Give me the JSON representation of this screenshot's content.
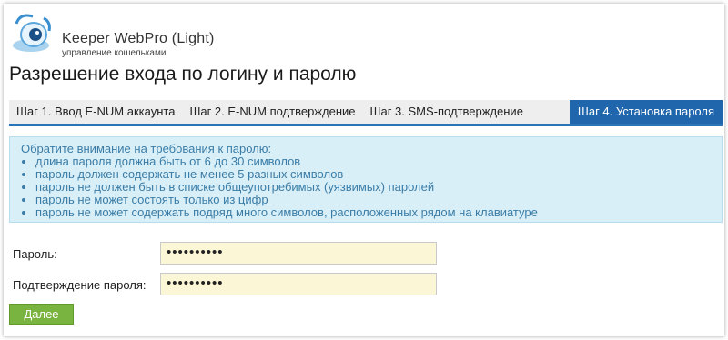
{
  "header": {
    "title": "Keeper WebPro (Light)",
    "subtitle": "управление кошельками"
  },
  "page_title": "Разрешение входа по логину и паролю",
  "steps": [
    {
      "label": "Шаг 1. Ввод E-NUM аккаунта",
      "active": false
    },
    {
      "label": "Шаг 2. E-NUM подтверждение",
      "active": false
    },
    {
      "label": "Шаг 3. SMS-подтверждение",
      "active": false
    },
    {
      "label": "Шаг 4. Установка пароля",
      "active": true
    }
  ],
  "info": {
    "intro": "Обратите внимание на требования к паролю:",
    "items": [
      "длина пароля должна быть от 6 до 30 символов",
      "пароль должен содержать не менее 5 разных символов",
      "пароль не должен быть в списке общеупотребимых (уязвимых) паролей",
      "пароль не может состоять только из цифр",
      "пароль не может содержать подряд много символов, расположенных рядом на клавиатуре"
    ]
  },
  "form": {
    "password_label": "Пароль:",
    "password_value": "••••••••••",
    "confirm_label": "Подтверждение пароля:",
    "confirm_value": "••••••••••"
  },
  "next_button": "Далее",
  "colors": {
    "active_step": "#1f66ad",
    "info_bg": "#d9eff8",
    "info_text": "#3a7ca6",
    "field_bg": "#fbf6d6",
    "button_bg": "#79b340"
  }
}
